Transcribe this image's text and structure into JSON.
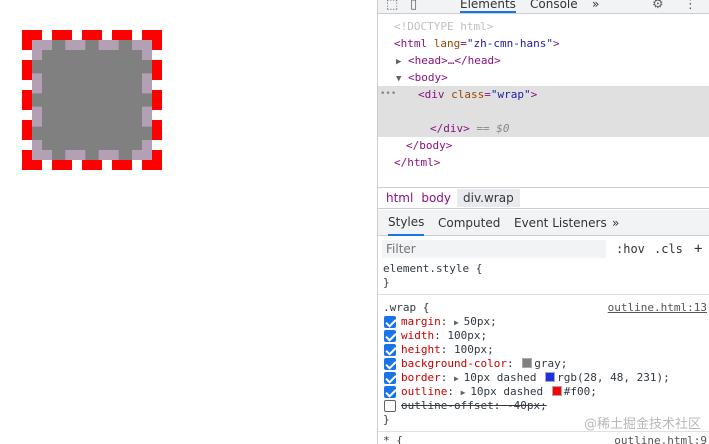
{
  "devtools": {
    "main_tabs": [
      "Elements",
      "Console"
    ],
    "more_tabs_glyph": "»",
    "elements_tree": {
      "doctype": "<!DOCTYPE html>",
      "html_open": "<html",
      "html_lang_attr": "lang",
      "html_lang_val": "\"zh-cmn-hans\"",
      "head": "<head>…</head>",
      "body_open": "<body>",
      "div_open": "<div",
      "div_class_attr": "class",
      "div_class_val": "\"wrap\"",
      "div_close": "</div>",
      "eq_ref": "== $0",
      "body_close": "</body>",
      "html_close": "</html>",
      "ellipsis": "•••"
    },
    "breadcrumb": [
      "html",
      "body",
      "div.wrap"
    ],
    "sub_tabs": [
      "Styles",
      "Computed",
      "Event Listeners"
    ],
    "filter": {
      "placeholder": "Filter",
      "hov": ":hov",
      "cls": ".cls",
      "add": "+"
    },
    "element_style": {
      "selector": "element.style {",
      "close": "}"
    },
    "wrap_rule": {
      "selector": ".wrap {",
      "source": "outline.html:13",
      "close": "}",
      "properties": [
        {
          "name": "margin",
          "value": "50px;",
          "checked": true,
          "expandable": true,
          "swatch": null,
          "struck": false
        },
        {
          "name": "width",
          "value": "100px;",
          "checked": true,
          "expandable": false,
          "swatch": null,
          "struck": false
        },
        {
          "name": "height",
          "value": "100px;",
          "checked": true,
          "expandable": false,
          "swatch": null,
          "struck": false
        },
        {
          "name": "background-color",
          "value": "gray;",
          "checked": true,
          "expandable": false,
          "swatch": "#808080",
          "struck": false
        },
        {
          "name": "border",
          "value": "10px dashed",
          "value2": "rgb(28, 48, 231);",
          "checked": true,
          "expandable": true,
          "swatch": "#1c30e7",
          "struck": false
        },
        {
          "name": "outline",
          "value": "10px dashed",
          "value2": "#f00;",
          "checked": true,
          "expandable": true,
          "swatch": "#ff0000",
          "struck": false
        },
        {
          "name": "outline-offset",
          "value": "-40px;",
          "checked": false,
          "expandable": false,
          "swatch": null,
          "struck": true
        }
      ]
    },
    "universal_rule": {
      "selector": "* {",
      "source": "outline.html:9"
    }
  },
  "watermark": "@稀土掘金技术社区",
  "colors": {
    "accent": "#1a73e8",
    "outline": "#ff0000",
    "box": "#808080"
  }
}
